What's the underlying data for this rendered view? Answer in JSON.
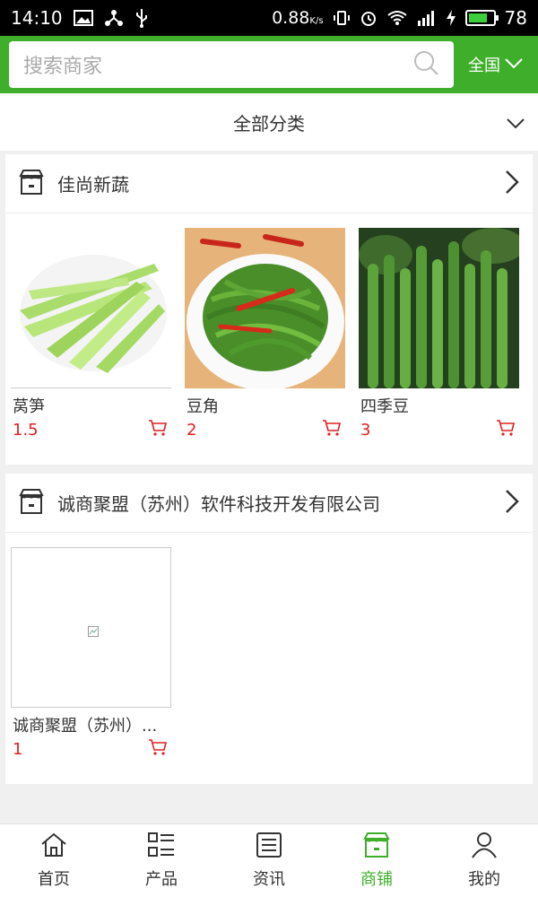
{
  "status_bar": {
    "time": "14:10",
    "speed": "0.88",
    "speed_unit": "K/s",
    "battery": "78",
    "battery_level": 0.78
  },
  "search": {
    "placeholder": "搜索商家",
    "region": "全国"
  },
  "category": {
    "label": "全部分类"
  },
  "shops": [
    {
      "name": "佳尚新蔬",
      "products": [
        {
          "name": "莴笋",
          "price": "1.5"
        },
        {
          "name": "豆角",
          "price": "2"
        },
        {
          "name": "四季豆",
          "price": "3"
        }
      ]
    },
    {
      "name": "诚商聚盟（苏州）软件科技开发有限公司",
      "products": [
        {
          "name": "诚商聚盟（苏州）...",
          "price": "1"
        }
      ]
    }
  ],
  "bottom_nav": [
    {
      "label": "首页",
      "icon": "home-icon"
    },
    {
      "label": "产品",
      "icon": "list-icon"
    },
    {
      "label": "资讯",
      "icon": "news-icon"
    },
    {
      "label": "商铺",
      "icon": "store-icon",
      "active": true
    },
    {
      "label": "我的",
      "icon": "user-icon"
    }
  ],
  "colors": {
    "brand_green": "#3fae2b",
    "price_red": "#e02020"
  }
}
